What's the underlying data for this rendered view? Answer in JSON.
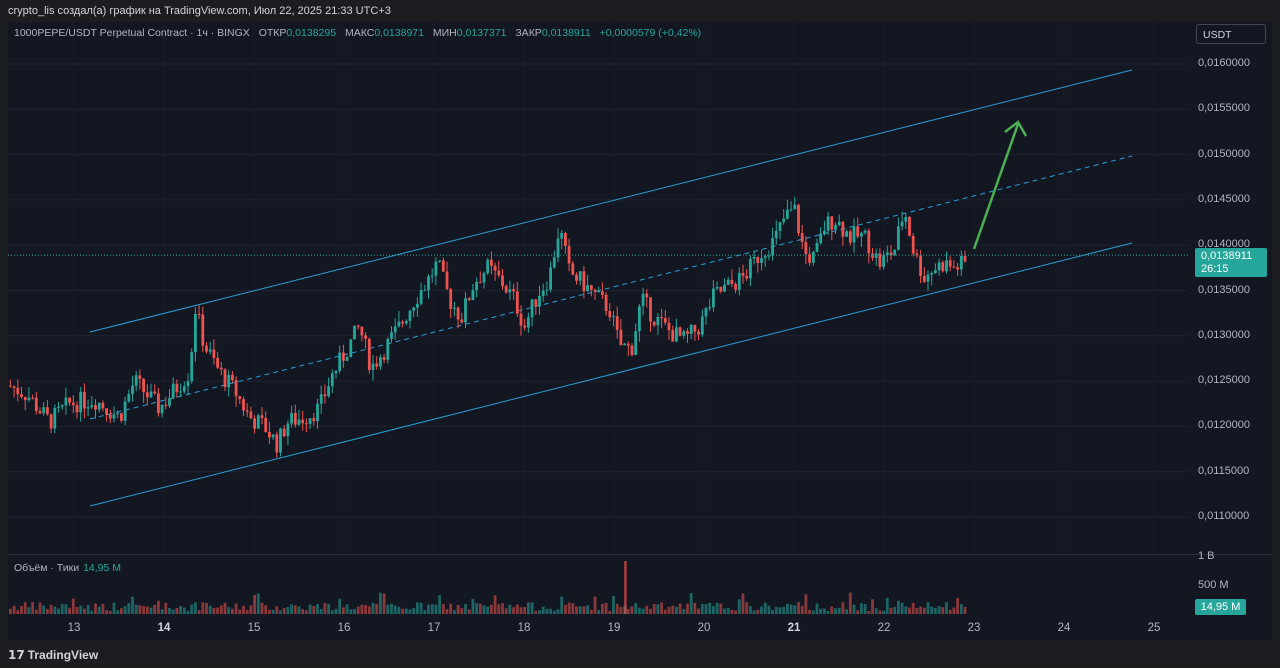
{
  "header": {
    "caption": "crypto_lis создал(а) график на TradingView.com, Июл 22, 2025 21:33 UTC+3"
  },
  "legend": {
    "symbol": "1000PEPE/USDT Perpetual Contract · 1ч · BINGX",
    "open_label": "ОТКР",
    "open_value": "0,0138295",
    "high_label": "МАКС",
    "high_value": "0,0138971",
    "low_label": "МИН",
    "low_value": "0,0137371",
    "close_label": "ЗАКР",
    "close_value": "0,0138911",
    "change": "+0,0000579 (+0,42%)"
  },
  "currency_badge": "USDT",
  "price_axis": [
    "0,0160000",
    "0,0155000",
    "0,0150000",
    "0,0145000",
    "0,0140000",
    "0,0135000",
    "0,0130000",
    "0,0125000",
    "0,0120000",
    "0,0115000",
    "0,0110000"
  ],
  "last_price": {
    "value": "0,0138911",
    "countdown": "26:15"
  },
  "volume": {
    "legend_label": "Объём · Тики",
    "legend_value": "14,95 M",
    "axis": [
      "1 B",
      "500 M"
    ],
    "badge": "14,95 M"
  },
  "time_axis": [
    {
      "label": "13",
      "bold": false
    },
    {
      "label": "14",
      "bold": true
    },
    {
      "label": "15",
      "bold": false
    },
    {
      "label": "16",
      "bold": false
    },
    {
      "label": "17",
      "bold": false
    },
    {
      "label": "18",
      "bold": false
    },
    {
      "label": "19",
      "bold": false
    },
    {
      "label": "20",
      "bold": false
    },
    {
      "label": "21",
      "bold": true
    },
    {
      "label": "22",
      "bold": false
    },
    {
      "label": "23",
      "bold": false
    },
    {
      "label": "24",
      "bold": false
    },
    {
      "label": "25",
      "bold": false
    }
  ],
  "footer": {
    "brand": "TradingView",
    "logo_icon": "tradingview-logo-icon"
  },
  "colors": {
    "up": "#26a69a",
    "down": "#ef5350",
    "channel": "#2a9fd6",
    "arrow": "#4caf50",
    "background": "#131722"
  },
  "chart_data": {
    "type": "candlestick",
    "y_range": [
      0.0106,
      0.0163
    ],
    "path_points": [
      [
        0,
        0.01245
      ],
      [
        18,
        0.01235
      ],
      [
        40,
        0.01205
      ],
      [
        60,
        0.01225
      ],
      [
        85,
        0.0123
      ],
      [
        110,
        0.0121
      ],
      [
        125,
        0.0125
      ],
      [
        150,
        0.0122
      ],
      [
        165,
        0.0124
      ],
      [
        180,
        0.0126
      ],
      [
        186,
        0.0133
      ],
      [
        195,
        0.0129
      ],
      [
        210,
        0.0126
      ],
      [
        225,
        0.0124
      ],
      [
        240,
        0.0121
      ],
      [
        255,
        0.012
      ],
      [
        268,
        0.0118
      ],
      [
        278,
        0.01205
      ],
      [
        295,
        0.0121
      ],
      [
        310,
        0.0122
      ],
      [
        322,
        0.01255
      ],
      [
        335,
        0.0128
      ],
      [
        350,
        0.0131
      ],
      [
        362,
        0.01265
      ],
      [
        375,
        0.01285
      ],
      [
        390,
        0.0131
      ],
      [
        405,
        0.0134
      ],
      [
        418,
        0.0136
      ],
      [
        428,
        0.0138
      ],
      [
        440,
        0.0134
      ],
      [
        452,
        0.0132
      ],
      [
        465,
        0.0136
      ],
      [
        478,
        0.01375
      ],
      [
        492,
        0.0136
      ],
      [
        505,
        0.0134
      ],
      [
        515,
        0.0131
      ],
      [
        528,
        0.01345
      ],
      [
        540,
        0.01365
      ],
      [
        550,
        0.0142
      ],
      [
        560,
        0.0137
      ],
      [
        572,
        0.0136
      ],
      [
        585,
        0.01345
      ],
      [
        600,
        0.0133
      ],
      [
        610,
        0.0129
      ],
      [
        622,
        0.01285
      ],
      [
        632,
        0.0134
      ],
      [
        645,
        0.0132
      ],
      [
        660,
        0.01305
      ],
      [
        675,
        0.01295
      ],
      [
        690,
        0.0131
      ],
      [
        705,
        0.01345
      ],
      [
        720,
        0.01355
      ],
      [
        735,
        0.01365
      ],
      [
        750,
        0.0139
      ],
      [
        765,
        0.01405
      ],
      [
        775,
        0.0143
      ],
      [
        785,
        0.0144
      ],
      [
        795,
        0.0139
      ],
      [
        805,
        0.01385
      ],
      [
        815,
        0.0142
      ],
      [
        825,
        0.0143
      ],
      [
        840,
        0.0141
      ],
      [
        855,
        0.0141
      ],
      [
        870,
        0.0138
      ],
      [
        885,
        0.01395
      ],
      [
        895,
        0.0144
      ],
      [
        905,
        0.0139
      ],
      [
        915,
        0.01365
      ],
      [
        925,
        0.01375
      ],
      [
        935,
        0.0138
      ],
      [
        945,
        0.01375
      ],
      [
        955,
        0.0138
      ]
    ]
  }
}
